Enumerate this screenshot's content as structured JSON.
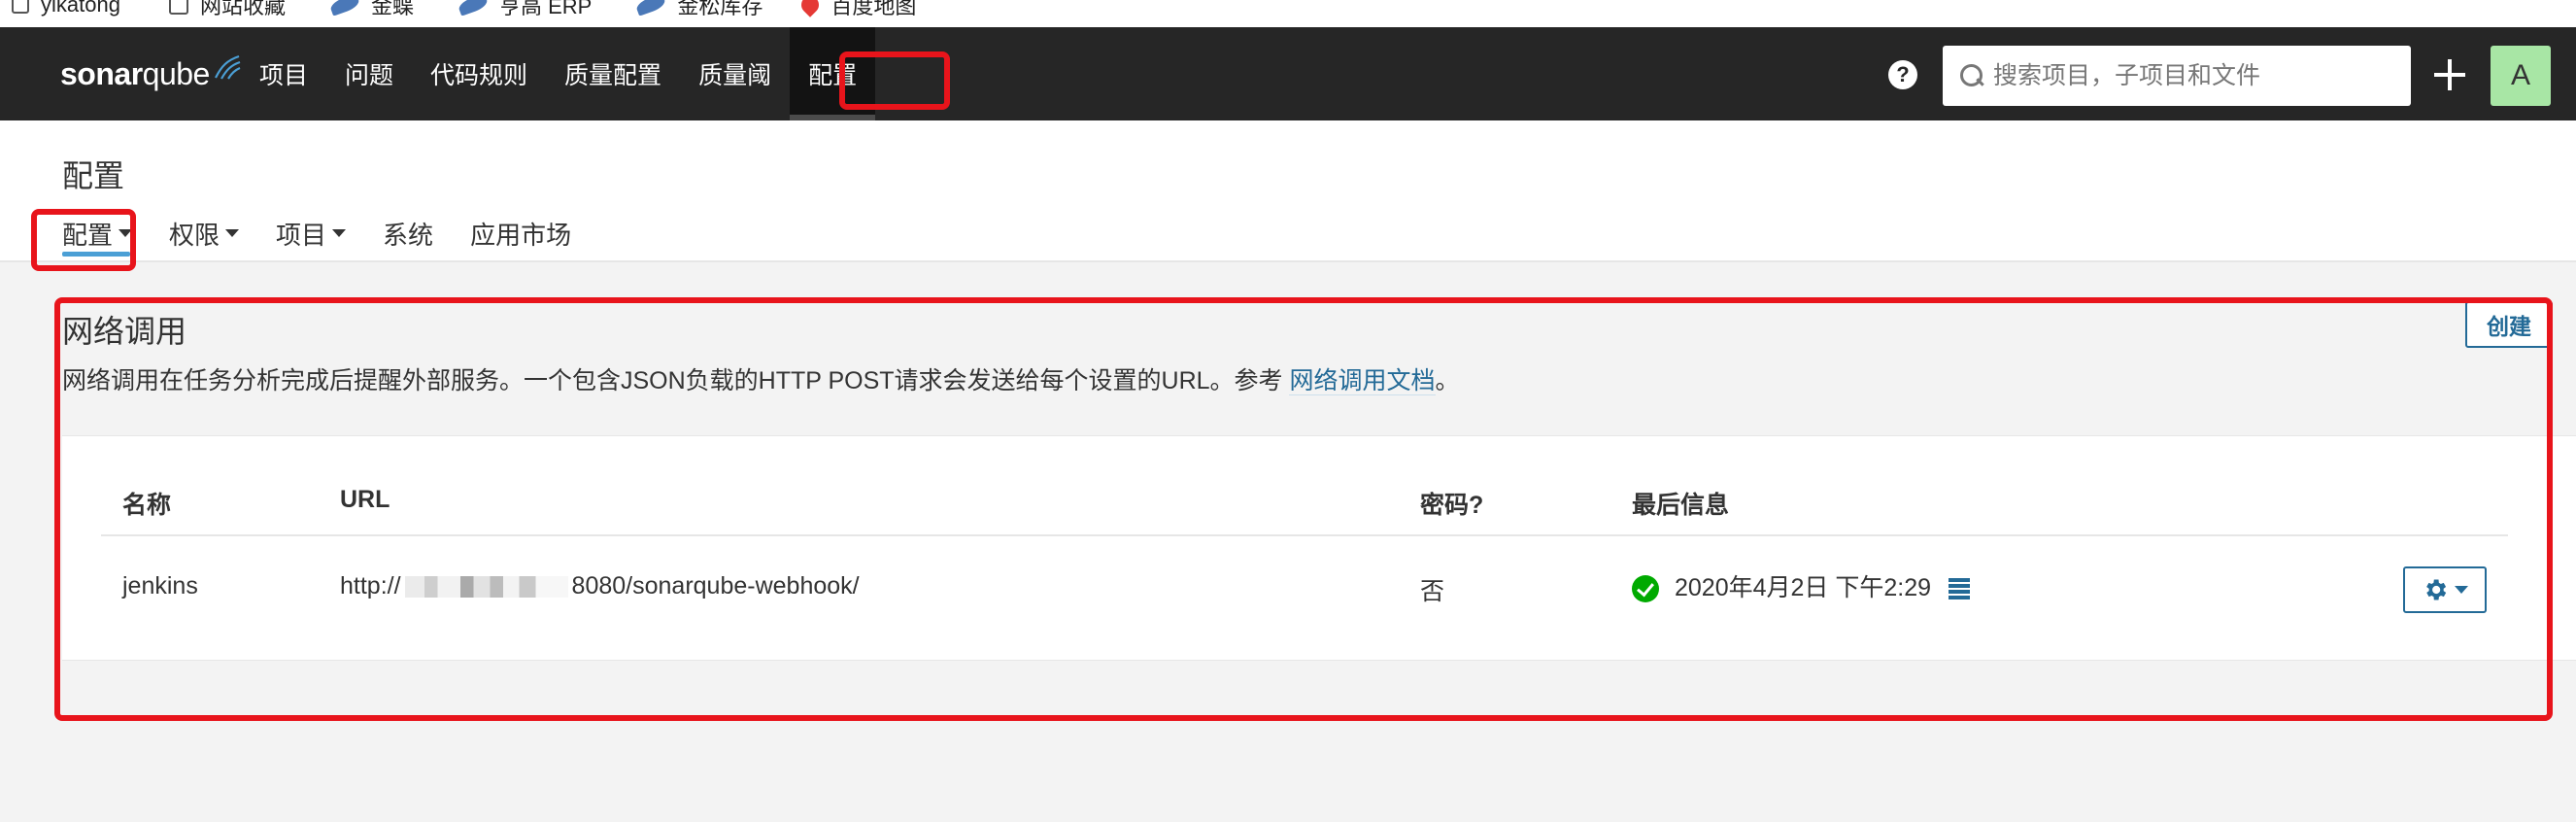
{
  "bookmarks": [
    "yikatong",
    "网站收藏",
    "金蝶",
    "亨高 ERP",
    "金松库存",
    "百度地图"
  ],
  "header": {
    "logo_bold": "sonar",
    "logo_light": "qube",
    "nav": [
      "项目",
      "问题",
      "代码规则",
      "质量配置",
      "质量阈",
      "配置"
    ],
    "active_nav": "配置",
    "help_label": "?",
    "search_placeholder": "搜索项目，子项目和文件",
    "avatar_letter": "A",
    "avatar_color": "#a8e6a5"
  },
  "page": {
    "title": "配置",
    "subnav": [
      {
        "label": "配置",
        "has_caret": true,
        "active": true
      },
      {
        "label": "权限",
        "has_caret": true
      },
      {
        "label": "项目",
        "has_caret": true
      },
      {
        "label": "系统",
        "has_caret": false
      },
      {
        "label": "应用市场",
        "has_caret": false
      }
    ]
  },
  "webhooks": {
    "title": "网络调用",
    "description": "网络调用在任务分析完成后提醒外部服务。一个包含JSON负载的HTTP POST请求会发送给每个设置的URL。参考",
    "doc_link": "网络调用文档",
    "description_end": "。",
    "create_label": "创建",
    "columns": [
      "名称",
      "URL",
      "密码?",
      "最后信息"
    ],
    "rows": [
      {
        "name": "jenkins",
        "url_prefix": "http://",
        "url_suffix": "8080/sonarqube-webhook/",
        "secret": "否",
        "last_delivery": "2020年4月2日 下午2:29",
        "status": "success"
      }
    ]
  },
  "colors": {
    "nav_bg": "#262626",
    "link": "#236a97",
    "success": "#00aa00",
    "annotation": "#e8141b"
  }
}
